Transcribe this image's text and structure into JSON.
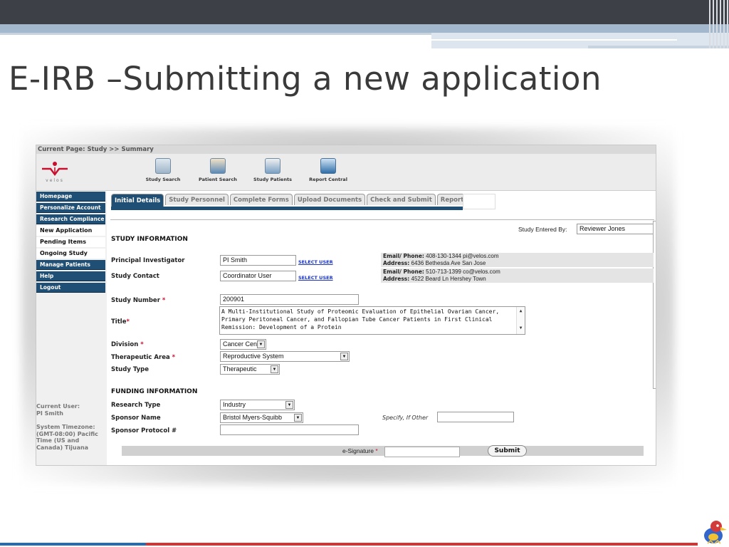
{
  "slide": {
    "title": "E-IRB –Submitting a new application"
  },
  "app": {
    "breadcrumb": "Current Page: Study >> Summary",
    "logo_text": "velos",
    "toolbar": [
      {
        "label": "Study Search",
        "icon": "study-search-icon"
      },
      {
        "label": "Patient Search",
        "icon": "patient-search-icon"
      },
      {
        "label": "Study Patients",
        "icon": "study-patients-icon"
      },
      {
        "label": "Report Central",
        "icon": "report-central-icon"
      }
    ],
    "sidebar": {
      "items": [
        {
          "label": "Homepage",
          "style": "dark"
        },
        {
          "label": "Personalize Account",
          "style": "dark"
        },
        {
          "label": "Research Compliance",
          "style": "dark"
        },
        {
          "label": "New Application",
          "style": "light"
        },
        {
          "label": "Pending Items",
          "style": "light"
        },
        {
          "label": "Ongoing Study",
          "style": "light"
        },
        {
          "label": "Manage Patients",
          "style": "dark"
        },
        {
          "label": "Help",
          "style": "dark"
        },
        {
          "label": "Logout",
          "style": "dark"
        }
      ],
      "current_user_label": "Current User:",
      "current_user": "PI Smith",
      "timezone_label": "System Timezone:",
      "timezone_line1": "(GMT-08:00) Pacific",
      "timezone_line2": "Time (US and",
      "timezone_line3": "Canada) Tijuana"
    },
    "tabs": [
      {
        "label": "Initial Details",
        "active": true
      },
      {
        "label": "Study Personnel",
        "active": false
      },
      {
        "label": "Complete Forms",
        "active": false
      },
      {
        "label": "Upload Documents",
        "active": false
      },
      {
        "label": "Check and Submit",
        "active": false
      },
      {
        "label": "Reports",
        "active": false
      }
    ],
    "study_entered_by_label": "Study Entered By:",
    "study_entered_by": "Reviewer Jones",
    "study_info": {
      "heading": "STUDY INFORMATION",
      "pi_label": "Principal Investigator",
      "pi_value": "PI Smith",
      "select_user": "SELECT USER",
      "pi_email_label": "Email/ Phone:",
      "pi_email_value": "408-130-1344 pi@velos.com",
      "pi_address_label": "Address:",
      "pi_address_value": "6436 Bethesda Ave San Jose",
      "contact_label": "Study Contact",
      "contact_value": "Coordinator User",
      "contact_email_label": "Email/ Phone:",
      "contact_email_value": "510-713-1399 co@velos.com",
      "contact_address_label": "Address:",
      "contact_address_value": "4522 Beard Ln Hershey Town",
      "study_number_label": "Study Number",
      "study_number_value": "200901",
      "title_label": "Title",
      "title_value": "A Multi-Institutional Study of Proteomic Evaluation of Epithelial Ovarian Cancer, Primary Peritoneal Cancer, and Fallopian Tube Cancer Patients in First Clinical Remission: Development of a Protein",
      "division_label": "Division",
      "division_value": "Cancer Center",
      "therapeutic_label": "Therapeutic Area",
      "therapeutic_value": "Reproductive System",
      "study_type_label": "Study Type",
      "study_type_value": "Therapeutic",
      "required_mark": "*"
    },
    "funding": {
      "heading": "FUNDING INFORMATION",
      "research_type_label": "Research Type",
      "research_type_value": "Industry",
      "sponsor_name_label": "Sponsor Name",
      "sponsor_name_value": "Bristol Myers-Squibb",
      "specify_label": "Specify, If Other",
      "specify_value": "",
      "sponsor_protocol_label": "Sponsor Protocol #",
      "sponsor_protocol_value": ""
    },
    "esignature_label": "e-Signature",
    "esignature_value": "",
    "submit_label": "Submit"
  }
}
